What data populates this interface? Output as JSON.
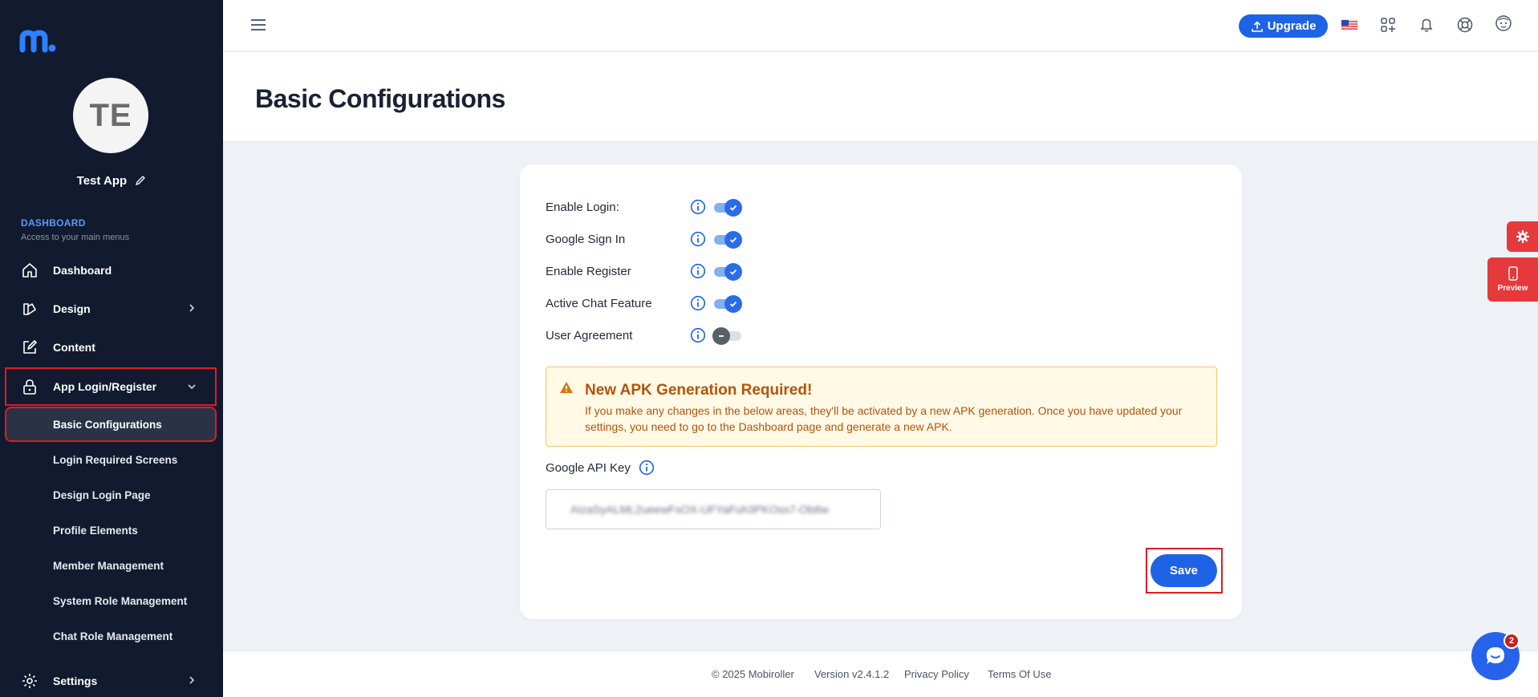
{
  "sidebar": {
    "avatar_initials": "TE",
    "app_name": "Test App",
    "section_title": "DASHBOARD",
    "section_subtitle": "Access to your main menus",
    "items": [
      {
        "label": "Dashboard",
        "icon": "home-icon"
      },
      {
        "label": "Design",
        "icon": "palette-icon"
      },
      {
        "label": "Content",
        "icon": "edit-icon"
      },
      {
        "label": "App Login/Register",
        "icon": "lock-icon"
      }
    ],
    "subitems": [
      {
        "label": "Basic Configurations",
        "active": true
      },
      {
        "label": "Login Required Screens"
      },
      {
        "label": "Design Login Page"
      },
      {
        "label": "Profile Elements"
      },
      {
        "label": "Member Management"
      },
      {
        "label": "System Role Management"
      },
      {
        "label": "Chat Role Management"
      }
    ],
    "settings": {
      "label": "Settings",
      "icon": "gear-icon"
    }
  },
  "topbar": {
    "upgrade_label": "Upgrade"
  },
  "page": {
    "title": "Basic Configurations"
  },
  "settings": [
    {
      "label": "Enable Login:",
      "enabled": true
    },
    {
      "label": "Google Sign In",
      "enabled": true
    },
    {
      "label": "Enable Register",
      "enabled": true
    },
    {
      "label": "Active Chat Feature",
      "enabled": true
    },
    {
      "label": "User Agreement",
      "enabled": false
    }
  ],
  "alert": {
    "title": "New APK Generation Required!",
    "body": "If you make any changes in the below areas, they'll be activated by a new APK generation. Once you have updated your settings, you need to go to the Dashboard page and generate a new APK."
  },
  "api_key": {
    "label": "Google API Key",
    "value": "AIzaSyALML2ueewFsOX-UFYaFuh3PKOss7-Ob8w"
  },
  "save_label": "Save",
  "footer": {
    "copyright": "© 2025 Mobiroller",
    "version": "Version v2.4.1.2",
    "privacy": "Privacy Policy",
    "terms": "Terms Of Use"
  },
  "floating": {
    "preview_label": "Preview",
    "chat_badge": "2"
  },
  "colors": {
    "sidebar_bg": "#111a2e",
    "primary": "#1e63e6",
    "accent_red": "#e5393b",
    "alert_text": "#b45309"
  }
}
